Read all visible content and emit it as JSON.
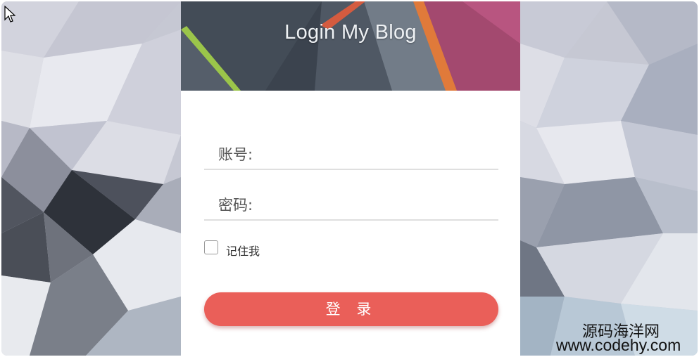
{
  "header": {
    "title": "Login My Blog"
  },
  "form": {
    "username_label": "账号:",
    "username_value": "",
    "password_label": "密码:",
    "password_value": "",
    "remember_label": "记住我",
    "remember_checked": false,
    "login_button": "登 录"
  },
  "watermark": {
    "name": "源码海洋网",
    "url": "www.codehy.com"
  },
  "colors": {
    "button": "#ea5f59",
    "header_dark": "#3c4450",
    "header_accent": "#a84a72"
  },
  "icons": [
    "mouse-cursor-icon",
    "checkbox-icon"
  ]
}
